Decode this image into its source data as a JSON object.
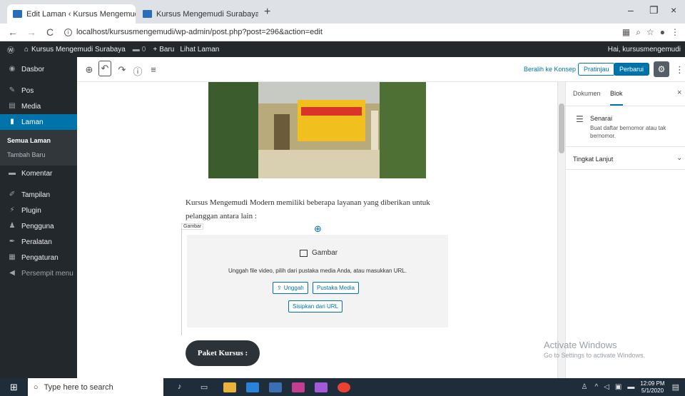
{
  "browser": {
    "tabs": [
      {
        "title": "Edit Laman ‹ Kursus Mengemudi",
        "close": "×"
      },
      {
        "title": "Kursus Mengemudi Surabaya",
        "close": "×"
      }
    ],
    "new_tab": "+",
    "window": {
      "minimize": "–",
      "restore": "❐",
      "close": "×"
    },
    "url": "localhost/kursusmengemudi/wp-admin/post.php?post=296&action=edit"
  },
  "adminbar": {
    "site": "Kursus Mengemudi Surabaya",
    "comments": "0",
    "new": "Baru",
    "view": "Lihat Laman",
    "greeting": "Hai, kursusmengemudi"
  },
  "sidebar": {
    "items": [
      {
        "label": "Dasbor"
      },
      {
        "label": "Pos"
      },
      {
        "label": "Media"
      },
      {
        "label": "Laman"
      },
      {
        "label": "Komentar"
      },
      {
        "label": "Tampilan"
      },
      {
        "label": "Plugin"
      },
      {
        "label": "Pengguna"
      },
      {
        "label": "Peralatan"
      },
      {
        "label": "Pengaturan"
      },
      {
        "label": "Persempit menu"
      }
    ],
    "sub": [
      "Semua Laman",
      "Tambah Baru"
    ]
  },
  "editor": {
    "switch_draft": "Beralih ke Konsep",
    "preview": "Pratinjau",
    "update": "Perbarui",
    "paragraph": "Kursus Mengemudi Modern memiliki beberapa layanan yang diberikan untuk pelanggan antara lain :",
    "block_label": "Gambar",
    "placeholder_title": "Gambar",
    "placeholder_desc": "Unggah file video, pilih dari pustaka media Anda, atau masukkan URL.",
    "upload": "Unggah",
    "media_library": "Pustaka Media",
    "insert_url": "Sisipkan dari URL",
    "heading_button": "Paket Kursus :"
  },
  "panel": {
    "tab_document": "Dokumen",
    "tab_block": "Blok",
    "block_name": "Senarai",
    "block_desc": "Buat daftar bernomor atau tak bernomor.",
    "advanced": "Tingkat Lanjut"
  },
  "watermark": {
    "title": "Activate Windows",
    "sub": "Go to Settings to activate Windows."
  },
  "taskbar": {
    "search": "Type here to search",
    "time": "12:09 PM",
    "date": "5/1/2020"
  },
  "colors": {
    "wp_blue": "#0073aa",
    "admin_dark": "#23282d",
    "taskbar": "#1f2d3a"
  }
}
